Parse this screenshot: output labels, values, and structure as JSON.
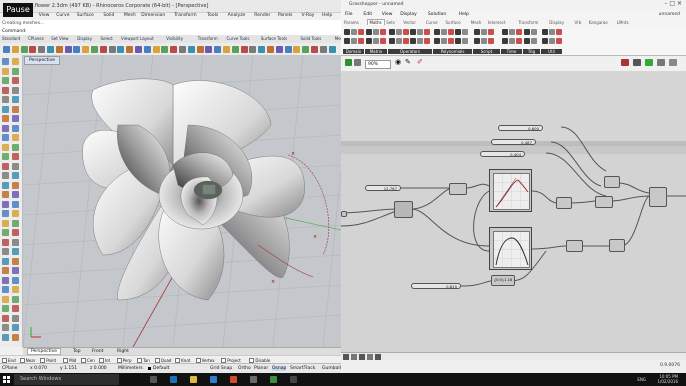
{
  "overlay": {
    "pause_label": "Pause"
  },
  "rhino": {
    "title": "...flower 2.3dm (497 KB) - Rhinoceros Corporate (64-bit) - [Perspective]",
    "menu": [
      "File",
      "Edit",
      "View",
      "Curve",
      "Surface",
      "Solid",
      "Mesh",
      "Dimension",
      "Transform",
      "Tools",
      "Analyze",
      "Render",
      "Panels",
      "V-Ray",
      "Help"
    ],
    "command_history": "Creating meshes...",
    "command_prompt": "Command:",
    "tabs": [
      "Standard",
      "CPlanes",
      "Set View",
      "Display",
      "Select",
      "Viewport Layout",
      "Visibility",
      "Transform",
      "Curve Tools",
      "Surface Tools",
      "Solid Tools",
      "Mesh Tools",
      "Render Tools",
      "Drafting"
    ],
    "viewport_label": "Perspective",
    "view_tabs": [
      "Perspective",
      "Top",
      "Front",
      "Right"
    ],
    "osnap": [
      "End",
      "Near",
      "Point",
      "Mid",
      "Cen",
      "Int",
      "Perp",
      "Tan",
      "Quad",
      "Knot",
      "Vertex",
      "Project",
      "Disable"
    ],
    "status": {
      "cplane": "CPlane",
      "x": "x 0.070",
      "y": "y 1.151",
      "z": "z 0.000",
      "units": "Millimeters",
      "layer": "Default",
      "grid_snap": "Grid Snap",
      "ortho": "Ortho",
      "planar": "Planar",
      "osnap": "Osnap",
      "smarttrack": "SmartTrack",
      "gumball": "Gumball"
    }
  },
  "grasshopper": {
    "title": "Grasshopper - unnamed",
    "menu": [
      "File",
      "Edit",
      "View",
      "Display",
      "Solution",
      "Help"
    ],
    "doc_name": "unnamed",
    "tabs": [
      "Params",
      "Maths",
      "Sets",
      "Vector",
      "Curve",
      "Surface",
      "Mesh",
      "Intersect",
      "Transform",
      "Display",
      "Vrb",
      "Kangaroo",
      "LMnts"
    ],
    "active_tab": "Maths",
    "groups": [
      "Domain",
      "Matrix",
      "Operators",
      "Polynomials",
      "Script",
      "Time",
      "Trig",
      "Util"
    ],
    "zoom": "90%",
    "sliders": {
      "s1": "0.600",
      "s2": "0.487",
      "s3": "0.404",
      "s4": "12.767",
      "s5": "0.815"
    },
    "param_label": "{0;0}1.18",
    "status_version": "0.9.0076"
  },
  "taskbar": {
    "search_placeholder": "Search Windows",
    "lang": "ENG",
    "time": "10:05 PM",
    "date": "1/02/2016"
  }
}
